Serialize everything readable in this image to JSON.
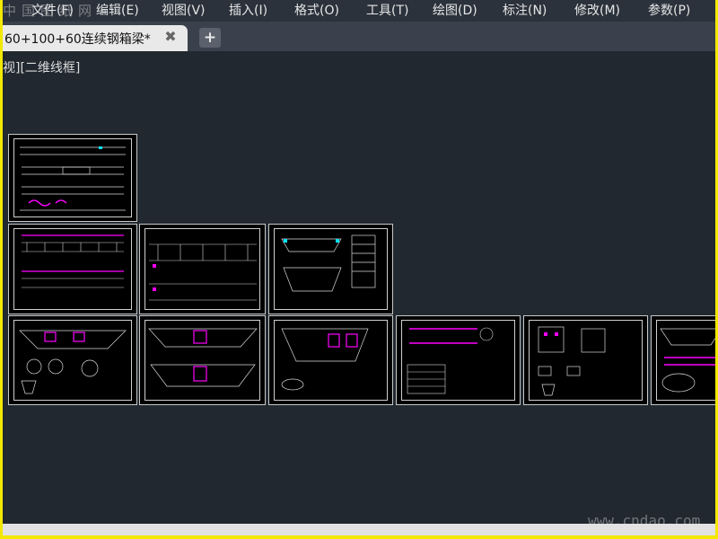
{
  "app": {
    "watermark_top": "中国图纸网",
    "watermark_bottom": "www.cndao.com"
  },
  "menubar": {
    "items": [
      {
        "label": "文件(F)"
      },
      {
        "label": "编辑(E)"
      },
      {
        "label": "视图(V)"
      },
      {
        "label": "插入(I)"
      },
      {
        "label": "格式(O)"
      },
      {
        "label": "工具(T)"
      },
      {
        "label": "绘图(D)"
      },
      {
        "label": "标注(N)"
      },
      {
        "label": "修改(M)"
      },
      {
        "label": "参数(P)"
      }
    ]
  },
  "tabs": {
    "active_label": "60+100+60连续钢箱梁*",
    "close_glyph": "✖",
    "new_glyph": "+"
  },
  "viewport": {
    "label": "视][二维线框]"
  },
  "colors": {
    "background": "#212830",
    "line": "#d9d9d9",
    "accent_magenta": "#ff00ff",
    "accent_cyan": "#00e5ff"
  }
}
